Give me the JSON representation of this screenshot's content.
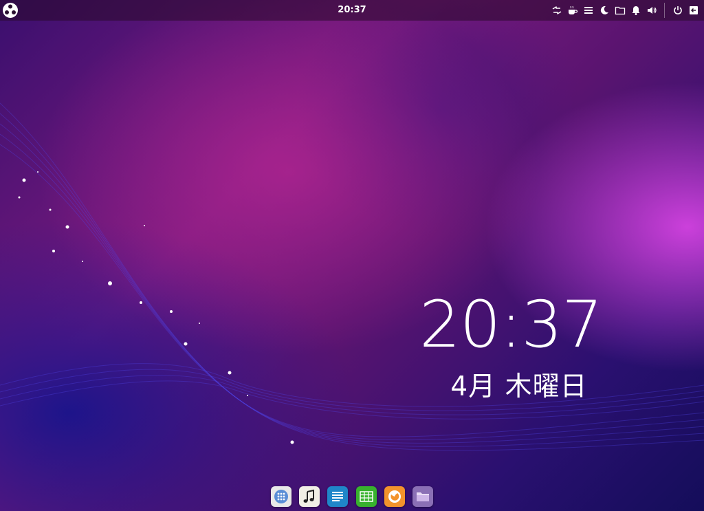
{
  "panel": {
    "clock": "20:37",
    "tray_icons": [
      "network-icon",
      "caffeine-icon",
      "menu-icon",
      "night-mode-icon",
      "folder-icon",
      "notification-bell-icon",
      "volume-icon",
      "power-icon",
      "logout-icon"
    ]
  },
  "desktop_clock": {
    "time": "20:37",
    "date": "4月 木曜日"
  },
  "dock": {
    "items": [
      "app-grid-icon",
      "music-player-icon",
      "text-editor-icon",
      "spreadsheet-icon",
      "firefox-icon",
      "file-manager-icon"
    ]
  },
  "colors": {
    "wallpaper_accent_magenta": "#ff50ff",
    "wallpaper_deep_blue": "#140d5a",
    "panel_bg": "rgba(40,10,40,0.55)"
  }
}
